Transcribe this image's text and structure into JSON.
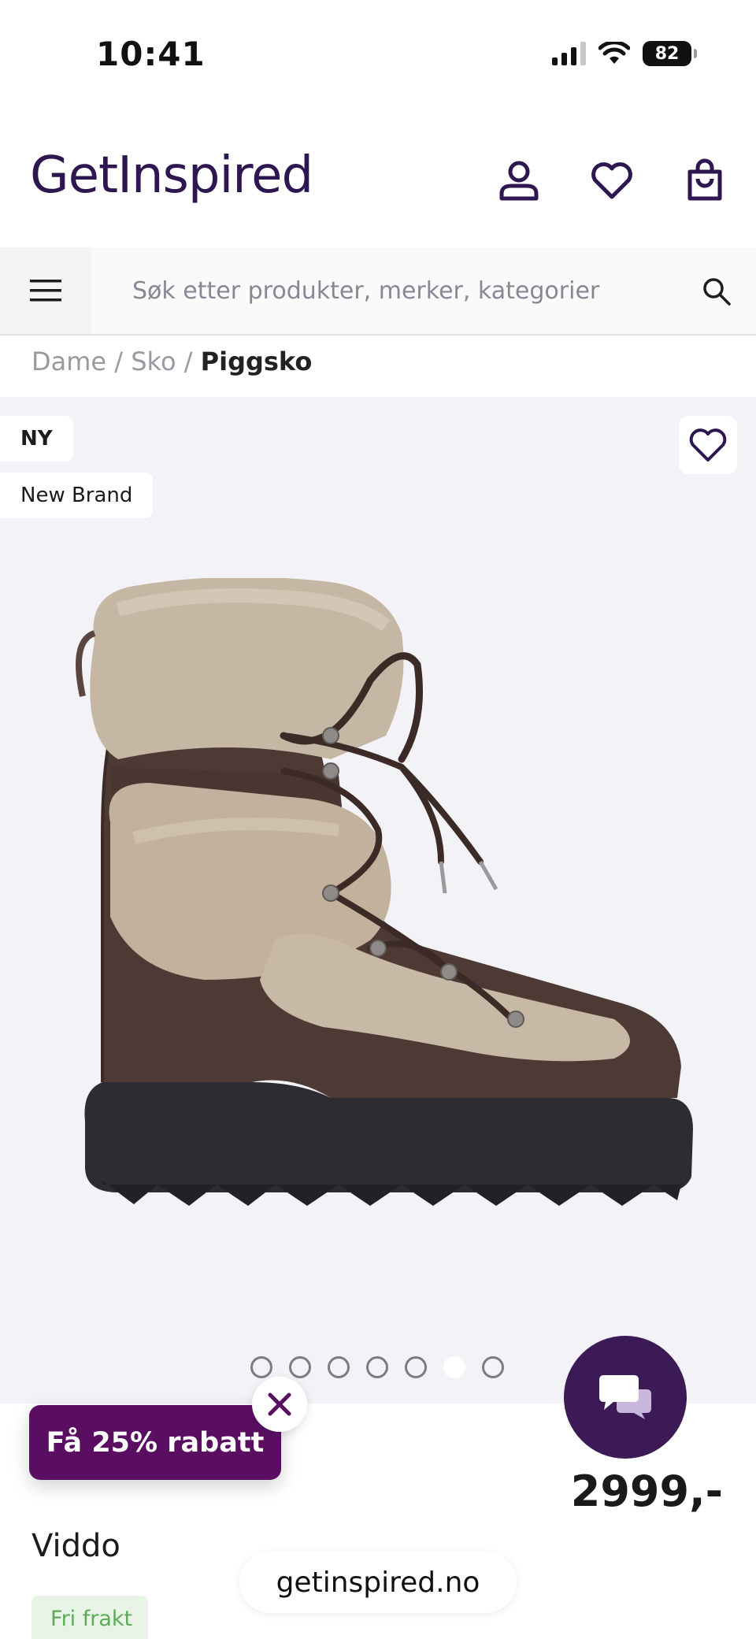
{
  "status_bar": {
    "time": "10:41",
    "battery": "82",
    "icons": [
      "signal-icon",
      "wifi-icon",
      "battery-icon"
    ]
  },
  "header": {
    "logo": "GetInspired",
    "icons": [
      "account-icon",
      "heart-icon",
      "cart-icon"
    ]
  },
  "search": {
    "placeholder": "Søk etter produkter, merker, kategorier"
  },
  "breadcrumb": {
    "items": [
      "Dame",
      "Sko"
    ],
    "separator": "/",
    "current": "Piggsko"
  },
  "product": {
    "tags": [
      "NY",
      "New Brand"
    ],
    "image": "brown lace-up winter boot with beige faux fur",
    "carousel": {
      "total": 7,
      "active": 6
    },
    "price": "2999,-",
    "brand": "Viddo",
    "shipping_badge": "Fri frakt"
  },
  "promo": {
    "label": "Få 25% rabatt"
  },
  "browser": {
    "url": "getinspired.no"
  },
  "colors": {
    "brand_purple": "#2e1750",
    "promo_purple": "#5a0e61",
    "chat_purple": "#3b1a56",
    "free_shipping_green": "#5eaa5a"
  }
}
